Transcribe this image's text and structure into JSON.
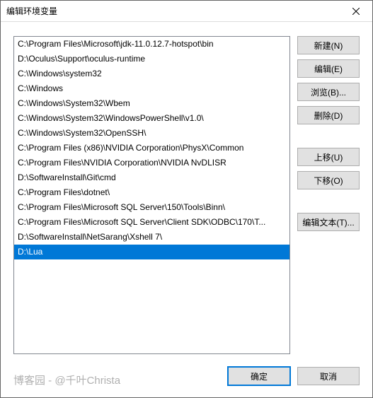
{
  "titlebar": {
    "title": "编辑环境变量"
  },
  "list": {
    "items": [
      "C:\\Program Files\\Microsoft\\jdk-11.0.12.7-hotspot\\bin",
      "D:\\Oculus\\Support\\oculus-runtime",
      "C:\\Windows\\system32",
      "C:\\Windows",
      "C:\\Windows\\System32\\Wbem",
      "C:\\Windows\\System32\\WindowsPowerShell\\v1.0\\",
      "C:\\Windows\\System32\\OpenSSH\\",
      "C:\\Program Files (x86)\\NVIDIA Corporation\\PhysX\\Common",
      "C:\\Program Files\\NVIDIA Corporation\\NVIDIA NvDLISR",
      "D:\\SoftwareInstall\\Git\\cmd",
      "C:\\Program Files\\dotnet\\",
      "C:\\Program Files\\Microsoft SQL Server\\150\\Tools\\Binn\\",
      "C:\\Program Files\\Microsoft SQL Server\\Client SDK\\ODBC\\170\\T...",
      "D:\\SoftwareInstall\\NetSarang\\Xshell 7\\",
      "D:\\Lua"
    ],
    "selected_index": 14
  },
  "buttons": {
    "new": "新建(N)",
    "edit": "编辑(E)",
    "browse": "浏览(B)...",
    "delete": "删除(D)",
    "move_up": "上移(U)",
    "move_down": "下移(O)",
    "edit_text": "编辑文本(T)..."
  },
  "footer": {
    "ok": "确定",
    "cancel": "取消",
    "watermark": "博客园 - @千叶Christa"
  }
}
